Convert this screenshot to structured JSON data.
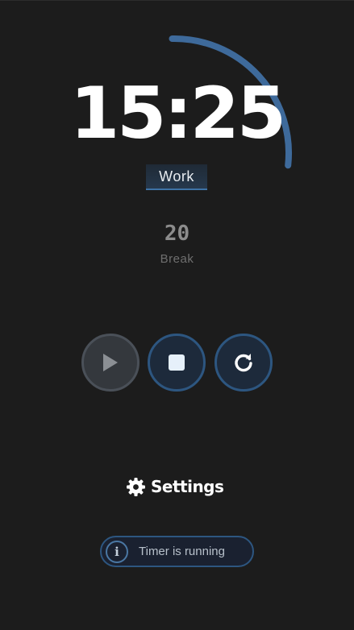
{
  "timer": {
    "time": "15:25",
    "mode": "Work",
    "progress": 0.27
  },
  "break": {
    "value": "20",
    "label": "Break"
  },
  "controls": {
    "play_icon": "play-icon",
    "stop_icon": "stop-icon",
    "reset_icon": "reset-icon"
  },
  "settings": {
    "label": "Settings",
    "icon": "gear-icon"
  },
  "status": {
    "text": "Timer is running",
    "icon": "info-icon"
  },
  "colors": {
    "background": "#1c1c1c",
    "accent": "#3e6a9b",
    "text": "#ffffff"
  }
}
